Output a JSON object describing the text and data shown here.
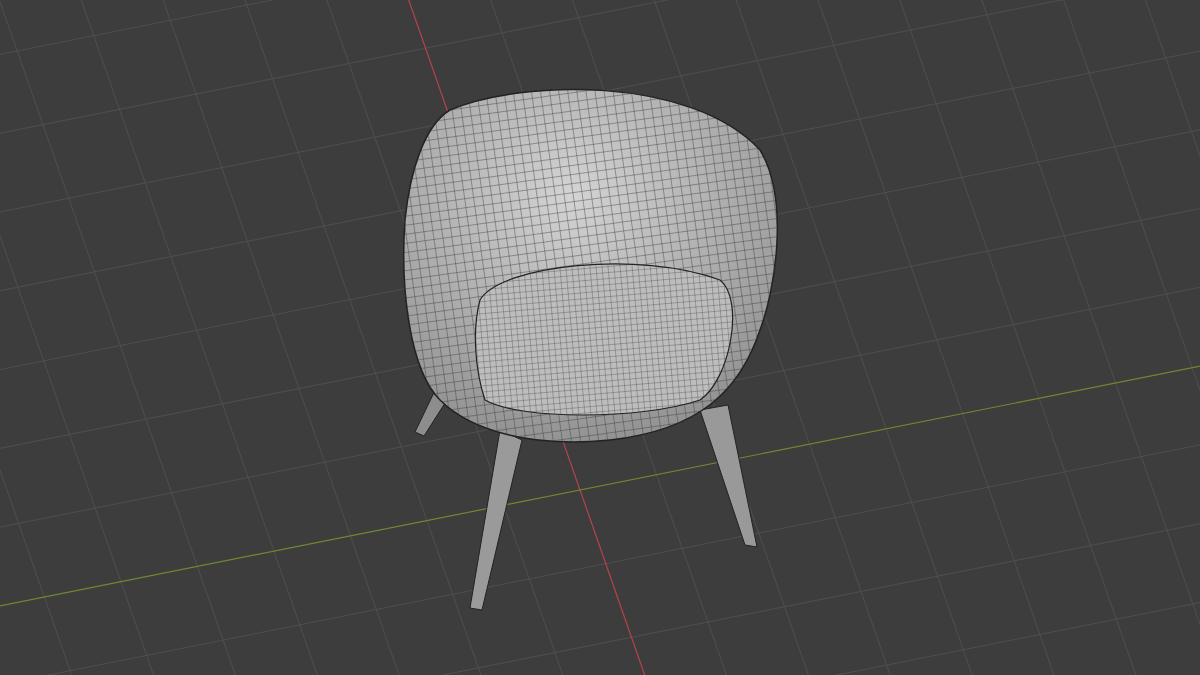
{
  "viewport": {
    "grid_visible": true,
    "axes": [
      {
        "kind": "x",
        "color": "#b8434b"
      },
      {
        "kind": "y",
        "color": "#6f8a2e"
      }
    ],
    "model": {
      "wireframe": true
    }
  }
}
